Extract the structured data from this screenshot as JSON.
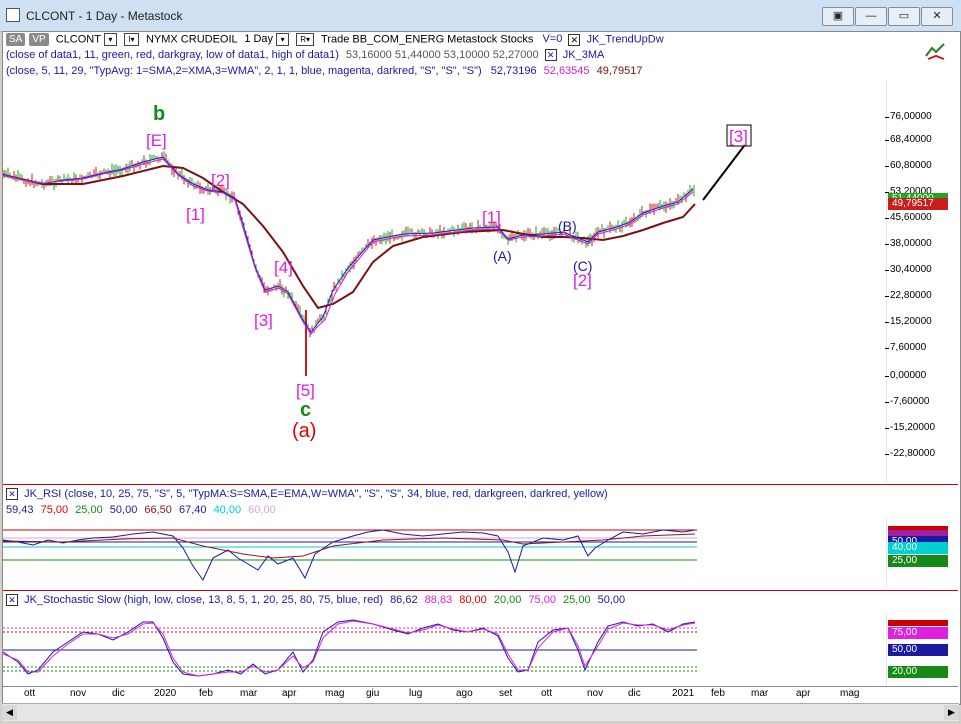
{
  "window": {
    "title": "CLCONT - 1 Day - Metastock",
    "buttons": [
      "▣",
      "—",
      "▭",
      "✕"
    ]
  },
  "toolbar": {
    "chip_sa": "SA",
    "chip_vp": "VP",
    "symbol": "CLCONT",
    "symbol_dd": "▾",
    "i_btn": "I▾",
    "exchange_name": "NYMX CRUDEOIL",
    "period": "1 Day",
    "period_dd": "▾",
    "r_btn": "R▾",
    "trade_info": "Trade  BB_COM_ENERG  Metastock  Stocks",
    "v_info": "V=0",
    "indicator1": "JK_TrendUpDw",
    "x_mark": "✕"
  },
  "study_lines": {
    "line1": {
      "params": "(close of data1,  11,  green,  red,  darkgray,  low of data1,  high of data1)",
      "values": "53,16000   51,44000   53,10000   52,27000",
      "name": "JK_3MA"
    },
    "line2": {
      "params": "(close,  5,  11,  29,  \"TypAvg: 1=SMA,2=XMA,3=WMA\",  2,  1,  1,  blue,  magenta,  darkred,  \"S\",  \"S\",  \"S\")",
      "v1": "52,73196",
      "v2": "52,63545",
      "v3": "49,79517"
    }
  },
  "price_axis": {
    "ticks": [
      "76,00000",
      "68,40000",
      "60,80000",
      "53,20000",
      "45,60000",
      "38,00000",
      "30,40000",
      "22,80000",
      "15,20000",
      "7,60000",
      "0,00000",
      "-7,60000",
      "-15,20000",
      "-22,80000"
    ],
    "last_green": "51,44000",
    "last_red": "49,79517"
  },
  "wave_labels": [
    {
      "text": "b",
      "color": "#168a16"
    },
    {
      "text": "[E]",
      "color": "#e020e0"
    },
    {
      "text": "[2]",
      "color": "#e020e0"
    },
    {
      "text": "[1]",
      "color": "#e020e0"
    },
    {
      "text": "[4]",
      "color": "#e020e0"
    },
    {
      "text": "[3]",
      "color": "#e020e0"
    },
    {
      "text": "[5]",
      "color": "#e020e0"
    },
    {
      "text": "c",
      "color": "#168a16"
    },
    {
      "text": "(a)",
      "color": "#e00000"
    },
    {
      "text": "[1]",
      "color": "#e020e0"
    },
    {
      "text": "(A)",
      "color": "#1a1aa0"
    },
    {
      "text": "(B)",
      "color": "#1a1aa0"
    },
    {
      "text": "(C)",
      "color": "#1a1aa0"
    },
    {
      "text": "[2]",
      "color": "#e020e0"
    },
    {
      "text": "[3]",
      "color": "#e020e0"
    }
  ],
  "rsi_panel": {
    "header": "JK_RSI   (close,  10,  25,  75,  \"S\",  5,   \"TypMA:S=SMA,E=EMA,W=WMA\",  \"S\",  \"S\",  34,  blue,  red,  darkgreen,  darkred,  yellow)",
    "values": [
      {
        "t": "59,43",
        "c": "#1a1aa0"
      },
      {
        "t": "75,00",
        "c": "#e00000"
      },
      {
        "t": "25,00",
        "c": "#168a16"
      },
      {
        "t": "50,00",
        "c": "#1a1aa0"
      },
      {
        "t": "66,50",
        "c": "#8b1a1a"
      },
      {
        "t": "67,40",
        "c": "#1a1aa0"
      },
      {
        "t": "40,00",
        "c": "#00d0d0"
      },
      {
        "t": "60,00",
        "c": "#e0a0e0"
      }
    ],
    "axis_labels": {
      "l50": "50,00",
      "l40": "40,00",
      "l25": "25,00"
    }
  },
  "stoch_panel": {
    "header": "JK_Stochastic Slow    (high,  low,  close,  13,  8,  5,  1,  20,  25,  80,  75,  blue,  red)",
    "values": [
      {
        "t": "86,62",
        "c": "#1a1aa0"
      },
      {
        "t": "88,83",
        "c": "#e020e0"
      },
      {
        "t": "80,00",
        "c": "#e00000"
      },
      {
        "t": "20,00",
        "c": "#168a16"
      },
      {
        "t": "75,00",
        "c": "#e020e0"
      },
      {
        "t": "25,00",
        "c": "#168a16"
      },
      {
        "t": "50,00",
        "c": "#1a1aa0"
      }
    ],
    "axis_labels": {
      "l75": "75,00",
      "l50": "50,00",
      "l20": "20,00"
    }
  },
  "months": [
    "ott",
    "nov",
    "dic",
    "2020",
    "feb",
    "mar",
    "apr",
    "mag",
    "giu",
    "lug",
    "ago",
    "set",
    "ott",
    "nov",
    "dic",
    "2021",
    "feb",
    "mar",
    "apr",
    "mag"
  ],
  "colors": {
    "green_bar": "#1ea81e",
    "red_bar": "#c81e1e",
    "ma_blue": "#2020d0",
    "ma_magenta": "#d020d0",
    "ma_darkred": "#7a1010",
    "grid_red": "#cc0000"
  }
}
